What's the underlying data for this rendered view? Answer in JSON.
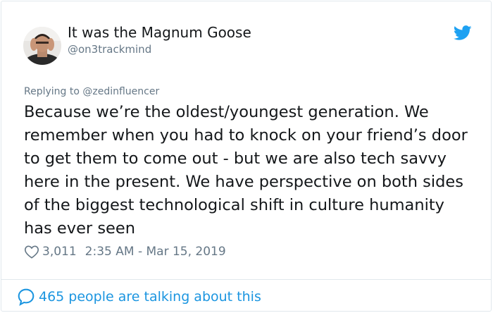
{
  "author": {
    "display_name": "It was the Magnum Goose",
    "handle": "@on3trackmind"
  },
  "icons": {
    "avatar": "profile-photo",
    "brand": "twitter-bird-icon",
    "like": "heart-outline-icon",
    "conversation": "speech-bubble-icon"
  },
  "tweet": {
    "replying_to": "Replying to @zedinfluencer",
    "text": "Because we’re the oldest/youngest generation. We remember when you had to knock on your friend’s door to get them to come out - but we are also tech savvy here in the present. We have perspective on both sides of the biggest technological shift in culture humanity has ever seen",
    "likes": "3,011",
    "timestamp": "2:35 AM - Mar 15, 2019"
  },
  "footer": {
    "conversation_text": "465 people are talking about this"
  },
  "colors": {
    "text_primary": "#14171a",
    "text_secondary": "#657786",
    "brand_blue": "#1da1f2",
    "link_blue": "#1b95e0",
    "border": "#e1e8ed"
  }
}
